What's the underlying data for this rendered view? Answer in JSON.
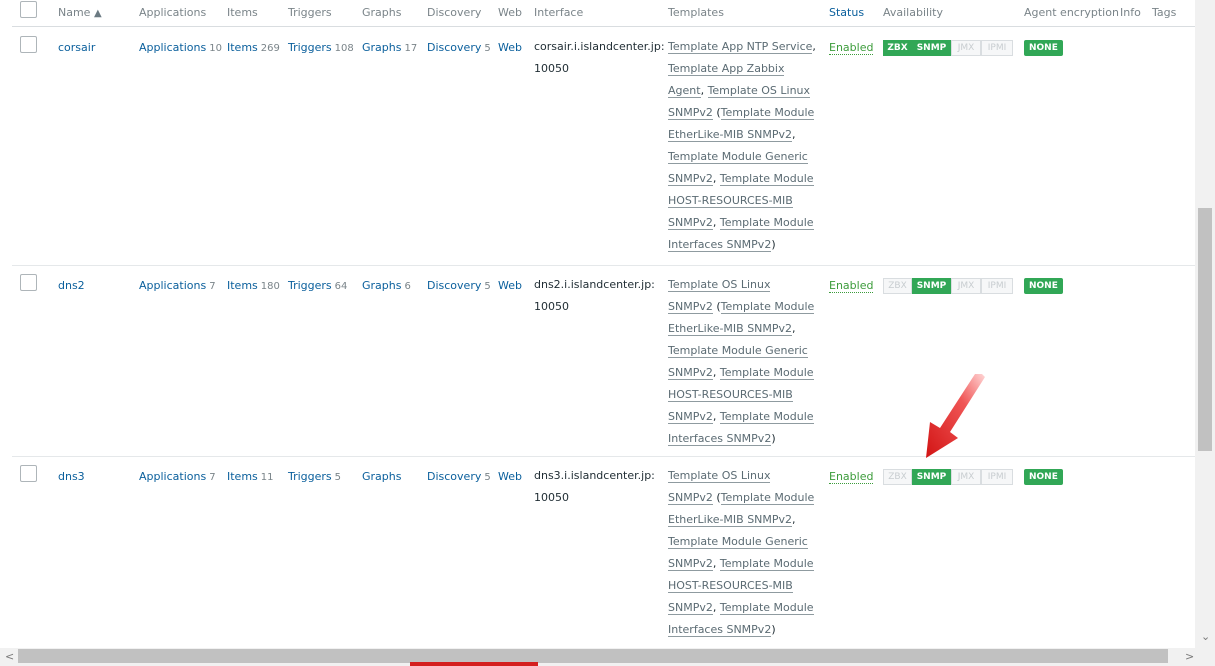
{
  "header": {
    "name": "Name",
    "sort_icon": "▲",
    "applications": "Applications",
    "items": "Items",
    "triggers": "Triggers",
    "graphs": "Graphs",
    "discovery": "Discovery",
    "web": "Web",
    "interface": "Interface",
    "templates": "Templates",
    "status": "Status",
    "availability": "Availability",
    "agent_encryption": "Agent encryption",
    "info": "Info",
    "tags": "Tags"
  },
  "hosts": [
    {
      "name": "corsair",
      "applications_label": "Applications",
      "applications_count": "10",
      "items_label": "Items",
      "items_count": "269",
      "triggers_label": "Triggers",
      "triggers_count": "108",
      "graphs_label": "Graphs",
      "graphs_count": "17",
      "discovery_label": "Discovery",
      "discovery_count": "5",
      "web": "Web",
      "interface_host": "corsair.i.islandcenter.jp:",
      "interface_port": "10050",
      "templates": [
        "Template App NTP Service",
        "Template App Zabbix Agent",
        "Template OS Linux SNMPv2",
        "Template Module EtherLike-MIB SNMPv2",
        "Template Module Generic SNMPv2",
        "Template Module HOST-RESOURCES-MIB SNMPv2",
        "Template Module Interfaces SNMPv2"
      ],
      "status": "Enabled",
      "availability": {
        "zbx": "ZBX",
        "snmp": "SNMP",
        "jmx": "JMX",
        "ipmi": "IPMI",
        "zbx_on": true,
        "snmp_on": true
      },
      "encryption": "NONE"
    },
    {
      "name": "dns2",
      "applications_label": "Applications",
      "applications_count": "7",
      "items_label": "Items",
      "items_count": "180",
      "triggers_label": "Triggers",
      "triggers_count": "64",
      "graphs_label": "Graphs",
      "graphs_count": "6",
      "discovery_label": "Discovery",
      "discovery_count": "5",
      "web": "Web",
      "interface_host": "dns2.i.islandcenter.jp:",
      "interface_port": "10050",
      "templates": [
        "Template OS Linux SNMPv2",
        "Template Module EtherLike-MIB SNMPv2",
        "Template Module Generic SNMPv2",
        "Template Module HOST-RESOURCES-MIB SNMPv2",
        "Template Module Interfaces SNMPv2"
      ],
      "status": "Enabled",
      "availability": {
        "zbx": "ZBX",
        "snmp": "SNMP",
        "jmx": "JMX",
        "ipmi": "IPMI",
        "zbx_on": false,
        "snmp_on": true
      },
      "encryption": "NONE"
    },
    {
      "name": "dns3",
      "applications_label": "Applications",
      "applications_count": "7",
      "items_label": "Items",
      "items_count": "11",
      "triggers_label": "Triggers",
      "triggers_count": "5",
      "graphs_label": "Graphs",
      "graphs_count": "",
      "discovery_label": "Discovery",
      "discovery_count": "5",
      "web": "Web",
      "interface_host": "dns3.i.islandcenter.jp:",
      "interface_port": "10050",
      "templates": [
        "Template OS Linux SNMPv2",
        "Template Module EtherLike-MIB SNMPv2",
        "Template Module Generic SNMPv2",
        "Template Module HOST-RESOURCES-MIB SNMPv2",
        "Template Module Interfaces SNMPv2"
      ],
      "status": "Enabled",
      "availability": {
        "zbx": "ZBX",
        "snmp": "SNMP",
        "jmx": "JMX",
        "ipmi": "IPMI",
        "zbx_on": false,
        "snmp_on": true
      },
      "encryption": "NONE"
    }
  ],
  "scrollbar": {
    "left_arrow": "<",
    "right_arrow": ">",
    "down_arrow": "⌄"
  },
  "colors": {
    "link": "#0a5f9c",
    "enabled": "#3c9c3b",
    "badge_green": "#31a756",
    "annotation_arrow": "#e02020"
  }
}
